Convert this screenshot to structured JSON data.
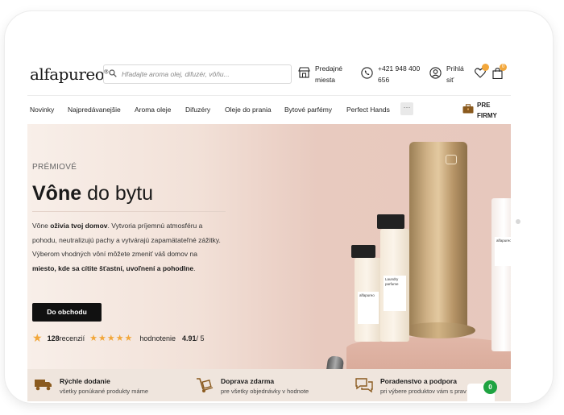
{
  "header": {
    "logo": "alfapureo",
    "logo_mark": "®",
    "search_placeholder": "Hľadajte aroma olej, difuzér, vôňu...",
    "stores_line1": "Predajné",
    "stores_line2": "miesta",
    "phone_line1": "+421 948 400",
    "phone_line2": "656",
    "login_line1": "Prihlá",
    "login_line2": "siť",
    "wishlist_count": "",
    "cart_count": "0"
  },
  "nav": {
    "items": [
      "Novinky",
      "Najpredávanejšie",
      "Aroma oleje",
      "Difuzéry",
      "Oleje do prania",
      "Bytové parfémy",
      "Perfect Hands"
    ],
    "more": "···",
    "business_line1": "PRE",
    "business_line2": "FIRMY"
  },
  "hero": {
    "eyebrow": "PRÉMIOVÉ",
    "title_bold": "Vône",
    "title_rest": " do bytu",
    "desc_1": "Vône ",
    "desc_2": "oživia tvoj domov",
    "desc_3": ". Vytvoria príjemnú atmosféru a pohodu, neutralizujú pachy a vytvárajú zapamätateľné zážitky. Výberom vhodných vôní môžete zmeniť váš domov na ",
    "desc_4": "miesto, kde sa cítite šťastní, uvoľnení a pohodlne",
    "desc_5": ".",
    "cta": "Do obchodu",
    "review_count": "128",
    "review_label": " recenzií",
    "stars": "★★★★★",
    "rating_label": "hodnotenie",
    "rating_value": "4.91",
    "rating_max": " / 5",
    "product_label_1": "alfapureo",
    "product_label_2": "Laundry parfume",
    "product_label_3": "alfapureo"
  },
  "features": [
    {
      "title": "Rýchle dodanie",
      "subtitle": "všetky ponúkané produkty máme"
    },
    {
      "title": "Doprava zdarma",
      "subtitle": "pre všetky objednávky v hodnote"
    },
    {
      "title": "Poradenstvo a podpora",
      "subtitle": "pri výbere produktov vám s prav"
    }
  ],
  "chat_badge": "0",
  "colors": {
    "accent": "#f2a73b",
    "cta": "#111111",
    "chat": "#1fa341"
  }
}
